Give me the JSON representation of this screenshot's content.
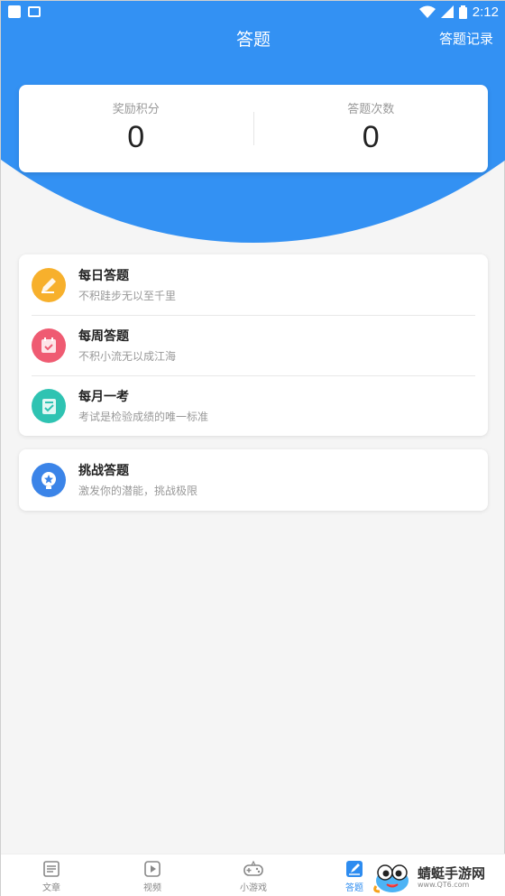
{
  "status_bar": {
    "time": "2:12",
    "icons": [
      "square-icon",
      "image-icon",
      "wifi-icon",
      "signal-icon",
      "battery-icon"
    ]
  },
  "appbar": {
    "title": "答题",
    "action": "答题记录"
  },
  "stats": {
    "points_label": "奖励积分",
    "points_value": "0",
    "count_label": "答题次数",
    "count_value": "0"
  },
  "quizzes": [
    {
      "title": "每日答题",
      "subtitle": "不积跬步无以至千里",
      "icon": "pencil-icon",
      "color": "#f7b02c"
    },
    {
      "title": "每周答题",
      "subtitle": "不积小流无以成江海",
      "icon": "calendar-check-icon",
      "color": "#ef5b72"
    },
    {
      "title": "每月一考",
      "subtitle": "考试是检验成绩的唯一标准",
      "icon": "clipboard-check-icon",
      "color": "#2fc3b2"
    }
  ],
  "challenge": {
    "title": "挑战答题",
    "subtitle": "激发你的潜能，挑战极限",
    "icon": "trophy-star-icon",
    "color": "#3b84e8"
  },
  "tabs": [
    {
      "label": "文章",
      "icon": "article-icon"
    },
    {
      "label": "视频",
      "icon": "video-icon"
    },
    {
      "label": "小游戏",
      "icon": "gamepad-icon"
    },
    {
      "label": "答题",
      "icon": "quiz-icon",
      "active": true
    }
  ],
  "watermark": {
    "text": "蜻蜓手游网",
    "sub": "www.QT6.com"
  },
  "colors": {
    "primary": "#3391f3",
    "active_tab": "#2d8cf0"
  }
}
